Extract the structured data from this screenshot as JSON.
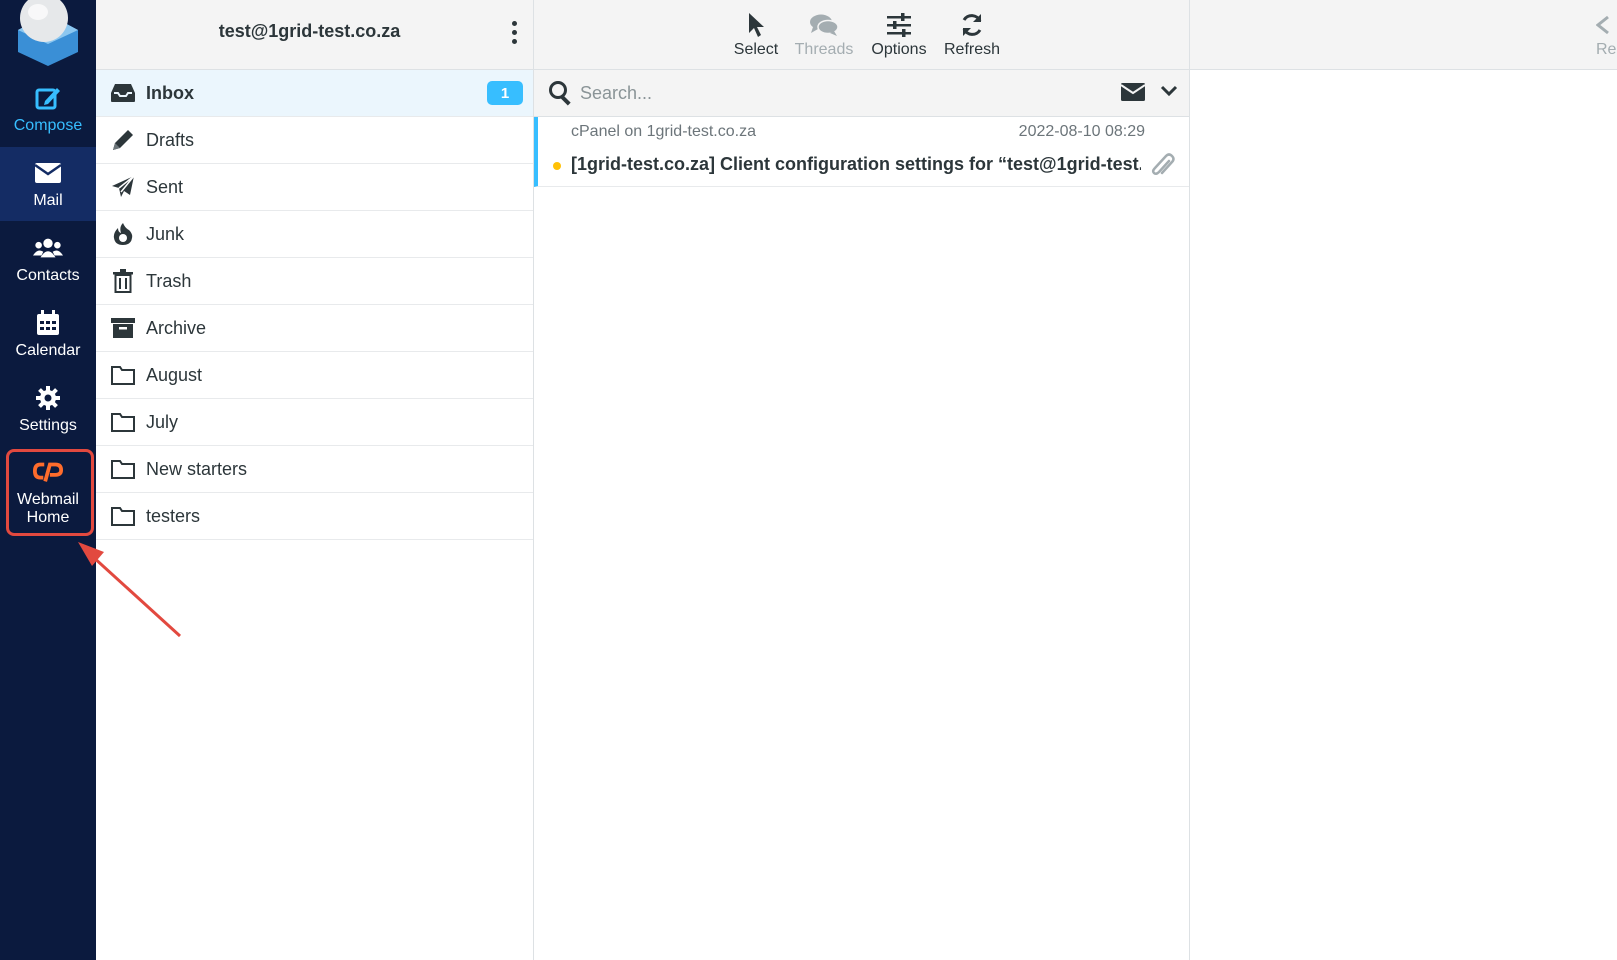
{
  "nav": {
    "compose": "Compose",
    "mail": "Mail",
    "contacts": "Contacts",
    "calendar": "Calendar",
    "settings": "Settings",
    "webmail_home_line1": "Webmail",
    "webmail_home_line2": "Home"
  },
  "folders_pane": {
    "account": "test@1grid-test.co.za",
    "items": [
      {
        "label": "Inbox",
        "icon": "inbox-icon",
        "unread": "1"
      },
      {
        "label": "Drafts",
        "icon": "pencil-icon"
      },
      {
        "label": "Sent",
        "icon": "paper-plane-icon"
      },
      {
        "label": "Junk",
        "icon": "fire-icon"
      },
      {
        "label": "Trash",
        "icon": "trash-icon"
      },
      {
        "label": "Archive",
        "icon": "archive-icon"
      },
      {
        "label": "August",
        "icon": "folder-icon"
      },
      {
        "label": "July",
        "icon": "folder-icon"
      },
      {
        "label": "New starters",
        "icon": "folder-icon"
      },
      {
        "label": "testers",
        "icon": "folder-icon"
      }
    ]
  },
  "toolbar": {
    "select": "Select",
    "threads": "Threads",
    "options": "Options",
    "refresh": "Refresh"
  },
  "search": {
    "placeholder": "Search..."
  },
  "messages": [
    {
      "from": "cPanel on 1grid-test.co.za",
      "date": "2022-08-10 08:29",
      "subject": "[1grid-test.co.za] Client configuration settings for “test@1grid-test...."
    }
  ],
  "preview": {
    "button_partial": "Re"
  },
  "colors": {
    "nav_bg": "#0b1a3e",
    "accent": "#37beff",
    "highlight": "#e2493f",
    "unread_dot": "#ffc107",
    "webmail_icon": "#ff6c2c"
  }
}
